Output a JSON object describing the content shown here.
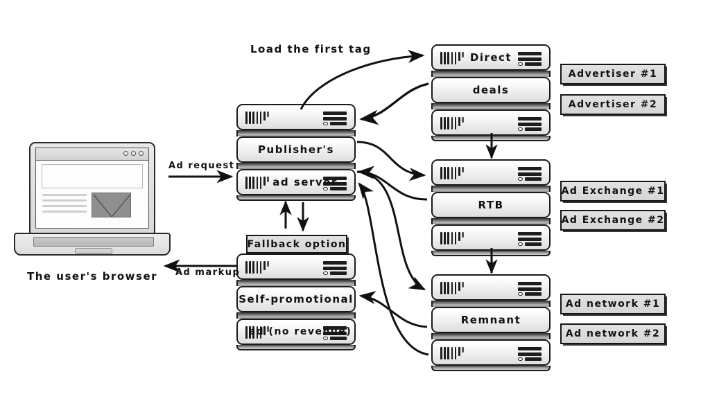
{
  "diagram": {
    "title_text_elements": {
      "load_first_tag": "Load the first tag",
      "ad_request": "Ad request",
      "ad_markup": "Ad markup",
      "user_browser": "The user's browser",
      "fallback_option": "Fallback option"
    },
    "colors": {
      "ink": "#121212",
      "server_body": "#f1f1f1",
      "box_fill": "#dcdcdc",
      "image_placeholder": "#8f8f8f"
    }
  },
  "browser": {
    "caption": "The user's browser",
    "dots_count": 3
  },
  "flows": {
    "ad_request": "Ad request",
    "ad_markup": "Ad markup",
    "load_first_tag": "Load the first tag"
  },
  "publisher_stack": {
    "name": "publisher-ad-server",
    "units": [
      {
        "label": "",
        "icons": true
      },
      {
        "label": "Publisher's",
        "icons": false
      },
      {
        "label": "ad server",
        "icons": true
      }
    ]
  },
  "fallback": {
    "badge": "Fallback option",
    "units": [
      {
        "label": "",
        "icons": true
      },
      {
        "label": "Self-promotional",
        "icons": false
      },
      {
        "label": "ad (no revenue)",
        "icons": true
      }
    ]
  },
  "direct_stack": {
    "units": [
      {
        "label": "Direct",
        "icons": true
      },
      {
        "label": "deals",
        "icons": false
      },
      {
        "label": "",
        "icons": true
      }
    ],
    "partners": [
      "Advertiser #1",
      "Advertiser #2"
    ]
  },
  "rtb_stack": {
    "units": [
      {
        "label": "",
        "icons": true
      },
      {
        "label": "RTB",
        "icons": false
      },
      {
        "label": "",
        "icons": true
      }
    ],
    "partners": [
      "Ad Exchange #1",
      "Ad Exchange #2"
    ]
  },
  "remnant_stack": {
    "units": [
      {
        "label": "",
        "icons": true
      },
      {
        "label": "Remnant",
        "icons": false
      },
      {
        "label": "",
        "icons": true
      }
    ],
    "partners": [
      "Ad network #1",
      "Ad network #2"
    ]
  }
}
